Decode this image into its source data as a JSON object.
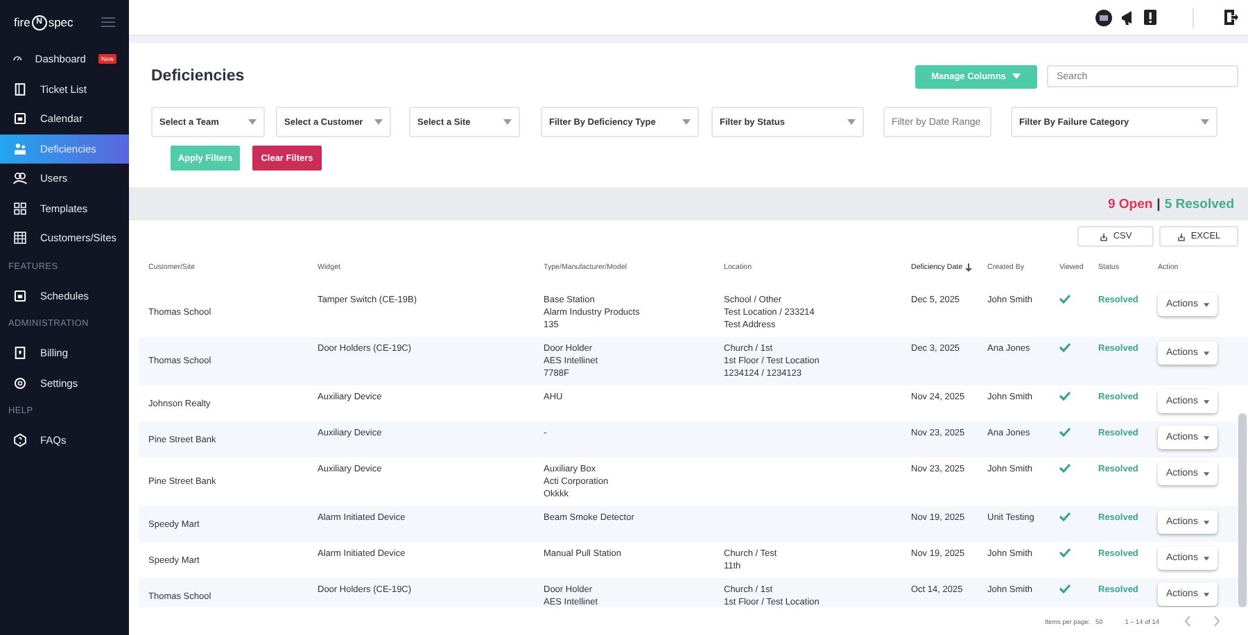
{
  "sidebar": {
    "logo": {
      "left": "fire",
      "mark": "N",
      "right": "spec"
    },
    "sections": [
      {
        "items": [
          {
            "label": "Dashboard",
            "badge": "New",
            "selected": false
          },
          {
            "label": "Ticket List",
            "selected": false
          },
          {
            "label": "Calendar",
            "selected": false
          },
          {
            "label": "Deficiencies",
            "selected": true
          },
          {
            "label": "Users",
            "selected": false
          },
          {
            "label": "Templates",
            "selected": false
          },
          {
            "label": "Customers/Sites",
            "selected": false
          }
        ]
      },
      {
        "header": "FEATURES",
        "items": [
          {
            "label": "Schedules",
            "selected": false
          }
        ]
      },
      {
        "header": "ADMINISTRATION",
        "items": [
          {
            "label": "Billing",
            "selected": false
          },
          {
            "label": "Settings",
            "selected": false
          }
        ]
      },
      {
        "header": "HELP",
        "items": [
          {
            "label": "FAQs",
            "selected": false
          }
        ]
      }
    ]
  },
  "page": {
    "title": "Deficiencies",
    "manage_columns": "Manage Columns",
    "search": {
      "placeholder": "Search"
    },
    "filters": [
      {
        "kind": "select",
        "label": "Select a Team"
      },
      {
        "kind": "select",
        "label": "Select a Customer"
      },
      {
        "kind": "select",
        "label": "Select a Site"
      },
      {
        "kind": "select",
        "label": "Filter By Deficiency Type"
      },
      {
        "kind": "select",
        "label": "Filter by Status"
      },
      {
        "kind": "input",
        "placeholder": "Filter by Date Range"
      },
      {
        "kind": "select",
        "label": "Filter By Failure Category"
      }
    ],
    "apply_button": "Apply Filters",
    "clear_button": "Clear Filters",
    "summary": {
      "open": "9 Open",
      "separator": "|",
      "resolved": "5 Resolved"
    },
    "exports": [
      "CSV",
      "EXCEL"
    ]
  },
  "table": {
    "columns": [
      {
        "label": "Customer/Site",
        "sorted": false
      },
      {
        "label": "Widget",
        "sorted": false
      },
      {
        "label": "Type/Manufacturer/Model",
        "sorted": false
      },
      {
        "label": "Location",
        "sorted": false
      },
      {
        "label": "Deficiency Date",
        "sorted": true
      },
      {
        "label": "Created By",
        "sorted": false
      },
      {
        "label": "Viewed",
        "sorted": false
      },
      {
        "label": "Status",
        "sorted": false
      },
      {
        "label": "Action",
        "sorted": false
      }
    ],
    "rows": [
      {
        "customer": "Thomas School",
        "widget": "Tamper Switch (CE-19B)",
        "type": [
          "Base Station",
          "Alarm Industry Products",
          "135"
        ],
        "location": [
          "School / Other",
          "Test Location / 233214",
          "Test Address"
        ],
        "date": "Dec 5, 2025",
        "created_by": "John Smith",
        "viewed": true,
        "status": "Resolved",
        "action": "Actions"
      },
      {
        "customer": "Thomas School",
        "widget": "Door Holders (CE-19C)",
        "type": [
          "Door Holder",
          "AES Intellinet",
          "7788F"
        ],
        "location": [
          "Church / 1st",
          "1st Floor / Test Location",
          "1234124 / 1234123"
        ],
        "date": "Dec 3, 2025",
        "created_by": "Ana Jones",
        "viewed": true,
        "status": "Resolved",
        "action": "Actions"
      },
      {
        "customer": "Johnson Realty",
        "widget": "Auxiliary Device",
        "type": [
          "AHU"
        ],
        "location": [],
        "date": "Nov 24, 2025",
        "created_by": "John Smith",
        "viewed": true,
        "status": "Resolved",
        "action": "Actions"
      },
      {
        "customer": "Pine Street Bank",
        "widget": "Auxiliary Device",
        "type": [
          "-"
        ],
        "location": [],
        "date": "Nov 23, 2025",
        "created_by": "Ana Jones",
        "viewed": true,
        "status": "Resolved",
        "action": "Actions"
      },
      {
        "customer": "Pine Street Bank",
        "widget": "Auxiliary Device",
        "type": [
          "Auxiliary Box",
          "Acti Corporation",
          "Okkkk"
        ],
        "location": [],
        "date": "Nov 23, 2025",
        "created_by": "John Smith",
        "viewed": true,
        "status": "Resolved",
        "action": "Actions"
      },
      {
        "customer": "Speedy Mart",
        "widget": "Alarm Initiated Device",
        "type": [
          "Beam Smoke Detector"
        ],
        "location": [],
        "date": "Nov 19, 2025",
        "created_by": "Unit Testing",
        "viewed": true,
        "status": "Resolved",
        "action": "Actions"
      },
      {
        "customer": "Speedy Mart",
        "widget": "Alarm Initiated Device",
        "type": [
          "Manual Pull Station"
        ],
        "location": [
          "Church / Test",
          "11th"
        ],
        "date": "Nov 19, 2025",
        "created_by": "John Smith",
        "viewed": true,
        "status": "Resolved",
        "action": "Actions"
      },
      {
        "customer": "Thomas School",
        "widget": "Door Holders (CE-19C)",
        "type": [
          "Door Holder",
          "AES Intellinet"
        ],
        "location": [
          "Church / 1st",
          "1st Floor / Test Location"
        ],
        "date": "Oct 14, 2025",
        "created_by": "John Smith",
        "viewed": true,
        "status": "Resolved",
        "action": "Actions"
      }
    ]
  },
  "pagination": {
    "items_per_page_label": "Items per page:",
    "items_per_page": "50",
    "range": "1 – 14 of 14"
  }
}
